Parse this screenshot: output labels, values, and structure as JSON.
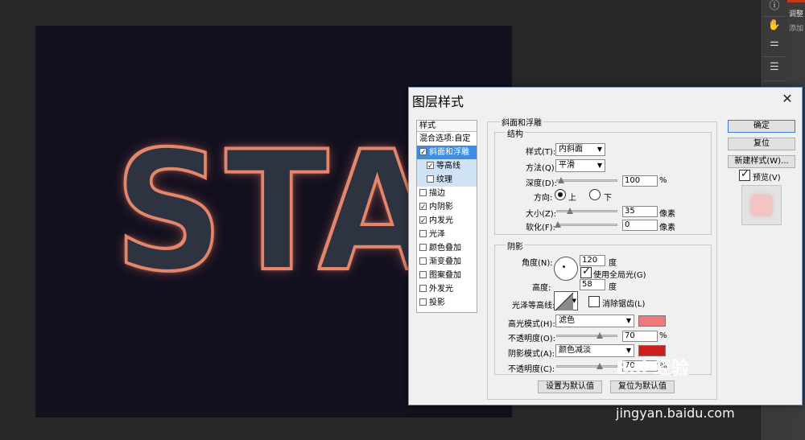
{
  "canvas": {
    "art_text": "STAR"
  },
  "right_panel": {
    "title": "调整",
    "subtitle": "添加"
  },
  "dialog": {
    "title": "图层样式",
    "close": "✕",
    "style_list": {
      "header": "样式",
      "items": [
        {
          "label": "混合选项:自定",
          "checkbox": false,
          "checked": false
        },
        {
          "label": "斜面和浮雕",
          "checkbox": true,
          "checked": true
        },
        {
          "label": "等高线",
          "checkbox": true,
          "checked": true
        },
        {
          "label": "纹理",
          "checkbox": true,
          "checked": false
        },
        {
          "label": "描边",
          "checkbox": true,
          "checked": false
        },
        {
          "label": "内阴影",
          "checkbox": true,
          "checked": true
        },
        {
          "label": "内发光",
          "checkbox": true,
          "checked": true
        },
        {
          "label": "光泽",
          "checkbox": true,
          "checked": false
        },
        {
          "label": "颜色叠加",
          "checkbox": true,
          "checked": false
        },
        {
          "label": "渐变叠加",
          "checkbox": true,
          "checked": false
        },
        {
          "label": "图案叠加",
          "checkbox": true,
          "checked": false
        },
        {
          "label": "外发光",
          "checkbox": true,
          "checked": false
        },
        {
          "label": "投影",
          "checkbox": true,
          "checked": false
        }
      ]
    },
    "bevel": {
      "title": "斜面和浮雕",
      "structure": {
        "title": "结构",
        "style_label": "样式(T):",
        "style_value": "内斜面",
        "method_label": "方法(Q):",
        "method_value": "平滑",
        "depth_label": "深度(D):",
        "depth_value": "100",
        "depth_unit": "%",
        "direction_label": "方向:",
        "dir_up": "上",
        "dir_down": "下",
        "size_label": "大小(Z):",
        "size_value": "35",
        "size_unit": "像素",
        "soften_label": "软化(F):",
        "soften_value": "0",
        "soften_unit": "像素"
      },
      "shading": {
        "title": "阴影",
        "angle_label": "角度(N):",
        "angle_value": "120",
        "angle_unit": "度",
        "global_light": "使用全局光(G)",
        "altitude_label": "高度:",
        "altitude_value": "58",
        "altitude_unit": "度",
        "gloss_label": "光泽等高线:",
        "antialias": "消除锯齿(L)",
        "highlight_label": "高光模式(H):",
        "highlight_value": "滤色",
        "highlight_color": "#f07a7a",
        "hl_opacity_label": "不透明度(O):",
        "hl_opacity_value": "70",
        "hl_opacity_unit": "%",
        "shadow_label": "阴影模式(A):",
        "shadow_value": "颜色减淡",
        "shadow_color": "#cc1e1e",
        "sh_opacity_label": "不透明度(C):",
        "sh_opacity_value": "70",
        "sh_opacity_unit": "%"
      },
      "set_default": "设置为默认值",
      "reset_default": "复位为默认值"
    },
    "buttons": {
      "ok": "确定",
      "reset": "复位",
      "new_style": "新建样式(W)...",
      "preview": "预览(V)"
    }
  },
  "watermark": {
    "logo": "Bai 经验",
    "url": "jingyan.baidu.com"
  }
}
